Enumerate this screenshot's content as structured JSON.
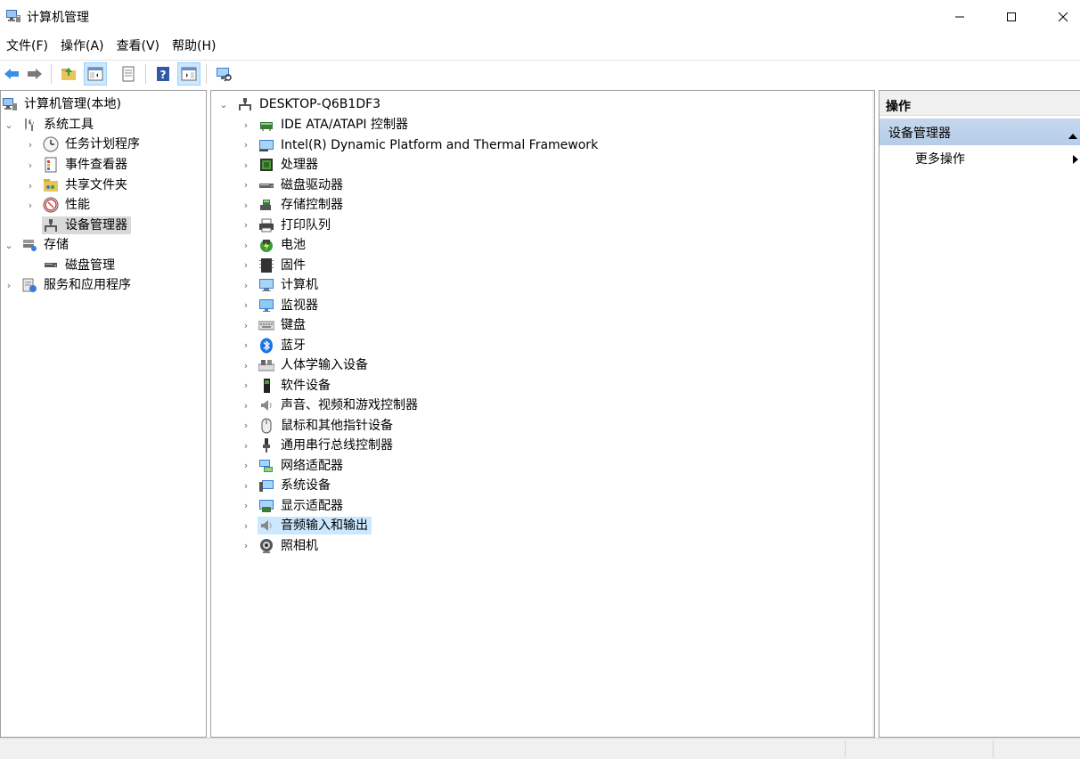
{
  "window": {
    "title": "计算机管理"
  },
  "menu": [
    "文件(F)",
    "操作(A)",
    "查看(V)",
    "帮助(H)"
  ],
  "left_tree": {
    "root": "计算机管理(本地)",
    "system_tools": "系统工具",
    "task_scheduler": "任务计划程序",
    "event_viewer": "事件查看器",
    "shared_folders": "共享文件夹",
    "performance": "性能",
    "device_manager": "设备管理器",
    "storage": "存储",
    "disk_management": "磁盘管理",
    "services_apps": "服务和应用程序"
  },
  "device_tree": {
    "computer_name": "DESKTOP-Q6B1DF3",
    "categories": [
      "IDE ATA/ATAPI 控制器",
      "Intel(R) Dynamic Platform and Thermal Framework",
      "处理器",
      "磁盘驱动器",
      "存储控制器",
      "打印队列",
      "电池",
      "固件",
      "计算机",
      "监视器",
      "键盘",
      "蓝牙",
      "人体学输入设备",
      "软件设备",
      "声音、视频和游戏控制器",
      "鼠标和其他指针设备",
      "通用串行总线控制器",
      "网络适配器",
      "系统设备",
      "显示适配器",
      "音频输入和输出",
      "照相机"
    ],
    "selected_index": 20
  },
  "actions": {
    "header": "操作",
    "section": "设备管理器",
    "more": "更多操作"
  },
  "colors": {
    "selection_blue": "#cce8ff",
    "selection_grey": "#d9d9d9",
    "actions_band": "#b6cde8"
  }
}
